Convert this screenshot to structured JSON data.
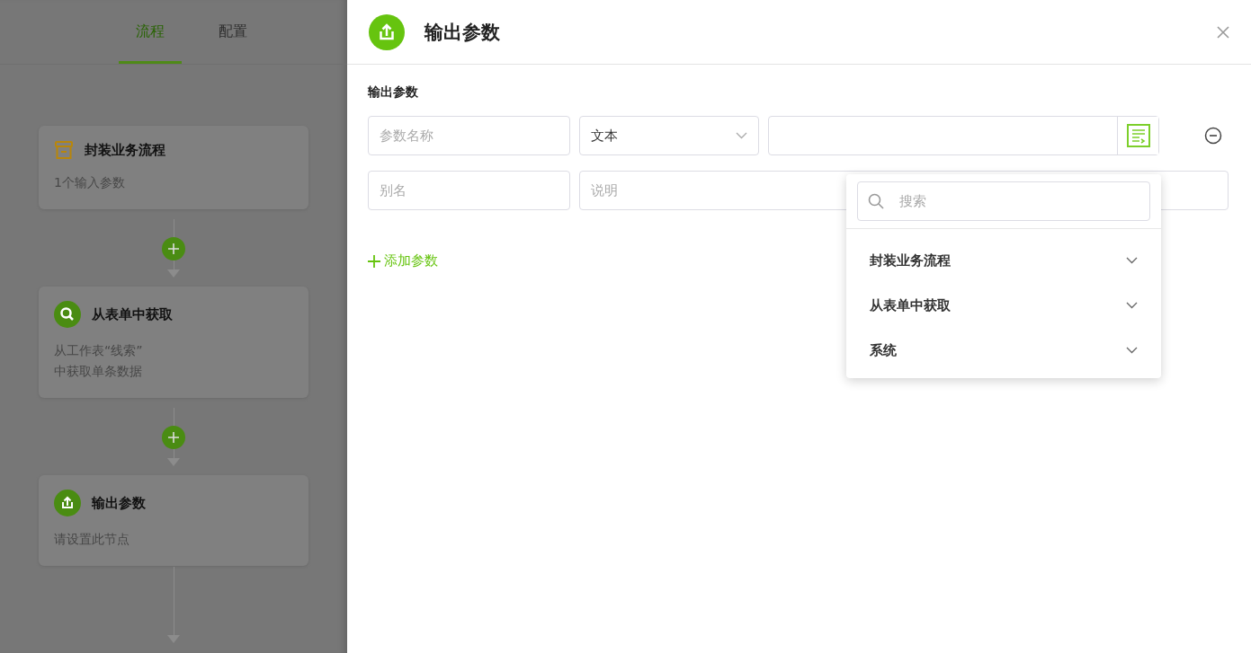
{
  "tabs": [
    {
      "label": "流程",
      "selected": true
    },
    {
      "label": "配置",
      "selected": false
    }
  ],
  "nodes": [
    {
      "kind": "package",
      "title": "封装业务流程",
      "description": "1个输入参数"
    },
    {
      "kind": "search",
      "title": "从表单中获取",
      "description": "从工作表“线索”\n中获取单条数据"
    },
    {
      "kind": "output",
      "title": "输出参数",
      "description": "请设置此节点"
    }
  ],
  "drawer": {
    "title": "输出参数",
    "section_label": "输出参数",
    "name_field": {
      "placeholder": "参数名称"
    },
    "type_select": {
      "value": "文本"
    },
    "alias_field": {
      "placeholder": "别名"
    },
    "description_field": {
      "placeholder": "说明"
    },
    "add_button": "添加参数",
    "dropdown": {
      "search": {
        "placeholder": "搜索"
      },
      "groups": [
        {
          "label": "封装业务流程"
        },
        {
          "label": "从表单中获取"
        },
        {
          "label": "系统"
        }
      ]
    }
  }
}
